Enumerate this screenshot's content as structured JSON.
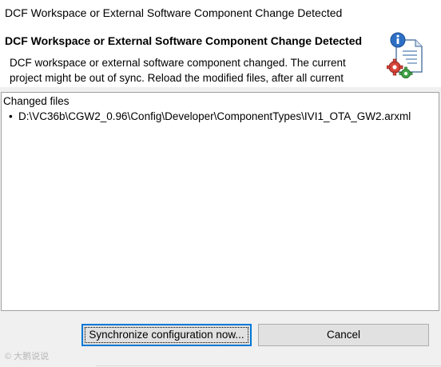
{
  "window": {
    "title": "DCF Workspace or External Software Component Change Detected"
  },
  "header": {
    "heading": "DCF Workspace or External Software Component Change Detected",
    "description_line1": "DCF workspace or external software component changed. The current",
    "description_line2": "project might be out of sync. Reload the modified files, after all current",
    "icon": "document-gear-info-icon"
  },
  "changes": {
    "title": "Changed files",
    "bullet": "•",
    "files": [
      "D:\\VC36b\\CGW2_0.96\\Config\\Developer\\ComponentTypes\\IVI1_OTA_GW2.arxml"
    ]
  },
  "buttons": {
    "synchronize_label": "Synchronize configuration now...",
    "cancel_label": "Cancel"
  },
  "watermark": {
    "text": "© 大鹅说说"
  },
  "colors": {
    "focus_border": "#0078d7",
    "button_bg": "#e1e1e1",
    "dialog_bg": "#f0f0f0"
  }
}
